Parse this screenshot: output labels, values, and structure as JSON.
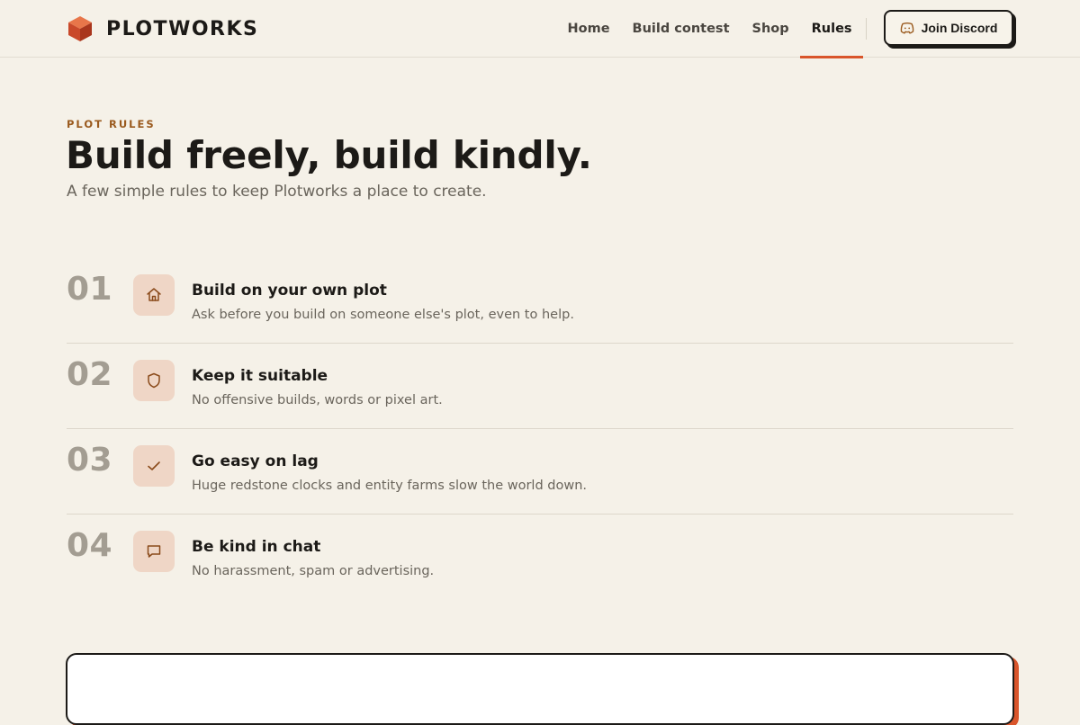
{
  "brand": {
    "name": "PLOTWORKS",
    "icon": "cube-icon",
    "accent": "#d9552b"
  },
  "nav": {
    "items": [
      {
        "label": "Home",
        "active": false
      },
      {
        "label": "Build contest",
        "active": false
      },
      {
        "label": "Shop",
        "active": false
      },
      {
        "label": "Rules",
        "active": true
      }
    ],
    "discord_label": "Join Discord",
    "discord_icon": "discord-icon"
  },
  "hero": {
    "eyebrow": "PLOT RULES",
    "title": "Build freely, build kindly.",
    "subtitle": "A few simple rules to keep Plotworks a place to create."
  },
  "rules": [
    {
      "number": "01",
      "icon": "home-icon",
      "title": "Build on your own plot",
      "description": "Ask before you build on someone else's plot, even to help."
    },
    {
      "number": "02",
      "icon": "shield-icon",
      "title": "Keep it suitable",
      "description": "No offensive builds, words or pixel art."
    },
    {
      "number": "03",
      "icon": "check-icon",
      "title": "Go easy on lag",
      "description": "Huge redstone clocks and entity farms slow the world down."
    },
    {
      "number": "04",
      "icon": "chat-bubble-icon",
      "title": "Be kind in chat",
      "description": "No harassment, spam or advertising."
    }
  ],
  "colors": {
    "background": "#f5f1e8",
    "accent": "#d9552b",
    "eyebrow": "#9a5a1e",
    "icon_tile": "#efd6c6"
  }
}
